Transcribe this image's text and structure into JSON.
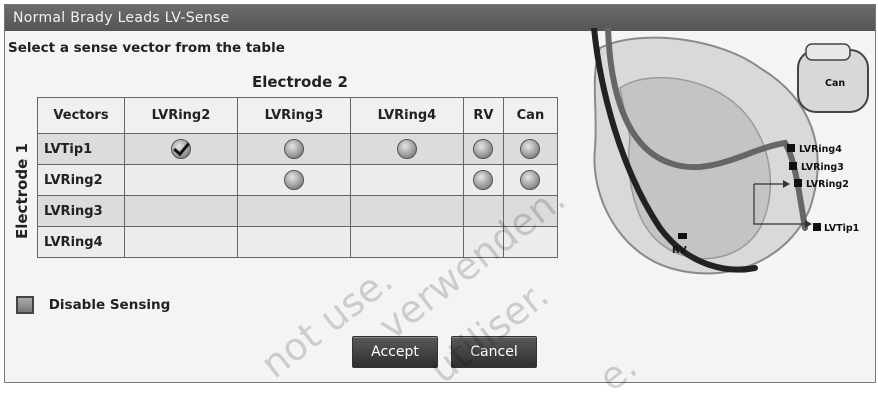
{
  "window": {
    "title": "Normal Brady Leads LV-Sense"
  },
  "prompt": "Select a sense vector from the table",
  "table": {
    "column_group_label": "Electrode 2",
    "row_group_label": "Electrode 1",
    "columns": [
      "Vectors",
      "LVRing2",
      "LVRing3",
      "LVRing4",
      "RV",
      "Can"
    ],
    "rows": [
      {
        "label": "LVTip1",
        "cells": [
          "checked",
          "radio",
          "radio",
          "radio",
          "radio"
        ]
      },
      {
        "label": "LVRing2",
        "cells": [
          "",
          "radio",
          "",
          "radio",
          "radio"
        ]
      },
      {
        "label": "LVRing3",
        "cells": [
          "",
          "",
          "",
          "",
          ""
        ]
      },
      {
        "label": "LVRing4",
        "cells": [
          "",
          "",
          "",
          "",
          ""
        ]
      }
    ]
  },
  "disable_sensing": {
    "label": "Disable Sensing",
    "checked": false
  },
  "buttons": {
    "accept": "Accept",
    "cancel": "Cancel"
  },
  "diagram": {
    "can_label": "Can",
    "rv_label": "RV",
    "lead_labels": [
      "LVRing4",
      "LVRing3",
      "LVRing2",
      "LVTip1"
    ]
  },
  "watermarks": [
    "not use.",
    "verwenden.",
    "utiliser.",
    "e."
  ]
}
